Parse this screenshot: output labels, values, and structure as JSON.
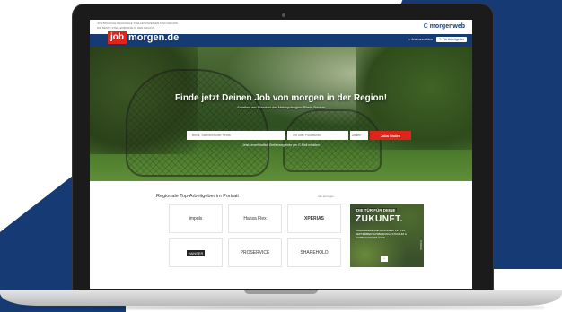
{
  "topbar": {
    "note_1": "JOB BRANCHE REGIONALE STELLENANZEIGEN MAIN REGION",
    "note_2": "DIE BESTE STELLENBÖRSE IN DER REGION",
    "brand_prefix": "C",
    "brand_name": "morgenweb"
  },
  "navbar": {
    "logo_box": "job",
    "logo_text": "morgen.de",
    "login_label": "Jetzt anmelden",
    "employer_label": "Für Arbeitgeber"
  },
  "hero": {
    "title": "Finde jetzt Deinen Job von morgen in der Region!",
    "subtitle": "Arbeiten am Standort der Metropolregion Rhein-Neckar",
    "search_placeholder": "Beruf, Stichwort oder Firma",
    "location_placeholder": "Ort oder Postleitzahl",
    "radius_value": "25 km",
    "search_button": "Jobs finden",
    "link_text": "Jetzt unverbindlich Stellenangebote per E-Mail erhalten"
  },
  "employers": {
    "heading": "Regionale Top-Arbeitgeber im Portrait",
    "all_link": "Alle anzeigen",
    "tiles": [
      {
        "name": "impuls"
      },
      {
        "name": "Hansa Flex"
      },
      {
        "name": "XPERIAS"
      },
      {
        "name": "HANSER"
      },
      {
        "name": "PROSERVICE"
      },
      {
        "name": "SHAREHOLD"
      }
    ]
  },
  "ad": {
    "line1": "DIE TÜR FÜR DEINE",
    "line2": "ZUKUNFT.",
    "body": "KARRIEREMESSE MANNHEIM 23. & 24. SEPTEMBER AUSBILDUNG, STUDIUM & AUSBILDUNGSPLÄTZE",
    "side": "ANZEIGE"
  }
}
